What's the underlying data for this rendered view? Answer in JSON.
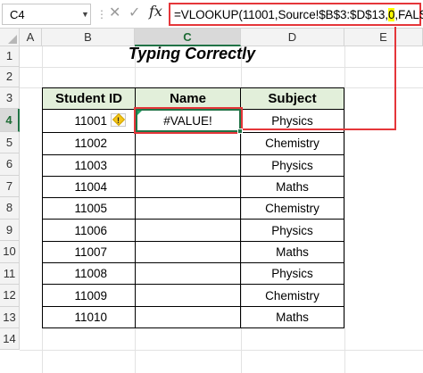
{
  "formula_bar": {
    "name_box": "C4",
    "cancel_icon": "✕",
    "enter_icon": "✓",
    "fx_label": "fx",
    "formula_prefix": "=VLOOKUP(11001,Source!$B$3:$D$13,",
    "formula_highlight": "0",
    "formula_suffix": ",FALSE)"
  },
  "columns": [
    "A",
    "B",
    "C",
    "D",
    "E"
  ],
  "rows": [
    "1",
    "2",
    "3",
    "4",
    "5",
    "6",
    "7",
    "8",
    "9",
    "10",
    "11",
    "12",
    "13",
    "14"
  ],
  "title": "Typing Correctly",
  "table": {
    "headers": [
      "Student ID",
      "Name",
      "Subject"
    ],
    "rows": [
      {
        "id": "11001",
        "name": "#VALUE!",
        "subject": "Physics"
      },
      {
        "id": "11002",
        "name": "",
        "subject": "Chemistry"
      },
      {
        "id": "11003",
        "name": "",
        "subject": "Physics"
      },
      {
        "id": "11004",
        "name": "",
        "subject": "Maths"
      },
      {
        "id": "11005",
        "name": "",
        "subject": "Chemistry"
      },
      {
        "id": "11006",
        "name": "",
        "subject": "Physics"
      },
      {
        "id": "11007",
        "name": "",
        "subject": "Maths"
      },
      {
        "id": "11008",
        "name": "",
        "subject": "Physics"
      },
      {
        "id": "11009",
        "name": "",
        "subject": "Chemistry"
      },
      {
        "id": "11010",
        "name": "",
        "subject": "Maths"
      }
    ]
  },
  "error_indicator": "!",
  "colors": {
    "accent": "#217346",
    "highlight_red": "#e5363a",
    "header_fill": "#e2efda",
    "formula_highlight": "#ffff00"
  }
}
